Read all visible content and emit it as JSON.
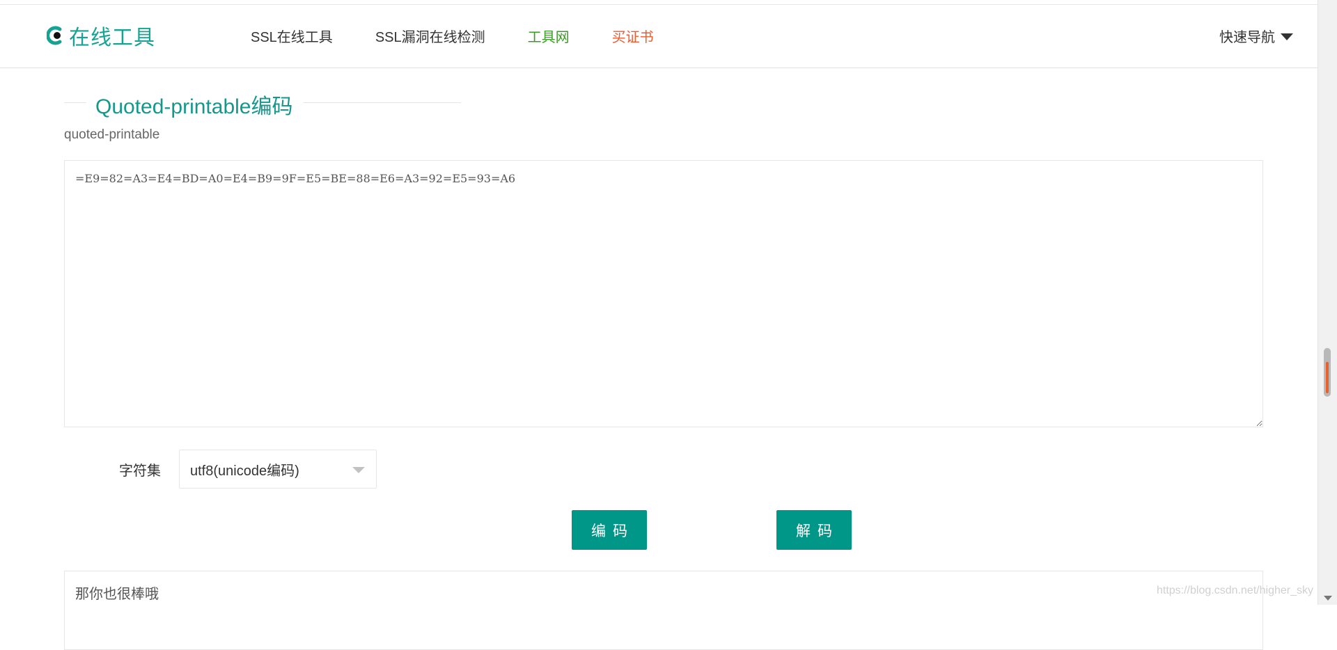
{
  "header": {
    "logo_text": "在线工具",
    "nav": [
      {
        "label": "SSL在线工具"
      },
      {
        "label": "SSL漏洞在线检测"
      },
      {
        "label": "工具网"
      },
      {
        "label": "买证书"
      }
    ],
    "quick_nav_label": "快速导航"
  },
  "main": {
    "title": "Quoted-printable编码",
    "subtitle": "quoted-printable",
    "input_value": "=E9=82=A3=E4=BD=A0=E4=B9=9F=E5=BE=88=E6=A3=92=E5=93=A6",
    "charset_label": "字符集",
    "charset_selected": "utf8(unicode编码)",
    "encode_label": "编码",
    "decode_label": "解码",
    "result_value": "那你也很棒哦",
    "watermark": "https://blog.csdn.net/higher_sky"
  },
  "colors": {
    "brand": "#009688",
    "nav_green": "#3a9b24",
    "nav_orange": "#ee5a2f",
    "scroll_highlight": "#e8612a"
  },
  "icons": {
    "logo": "logo-icon",
    "dropdown": "caret-down-icon",
    "select_arrow": "chevron-down-icon"
  }
}
